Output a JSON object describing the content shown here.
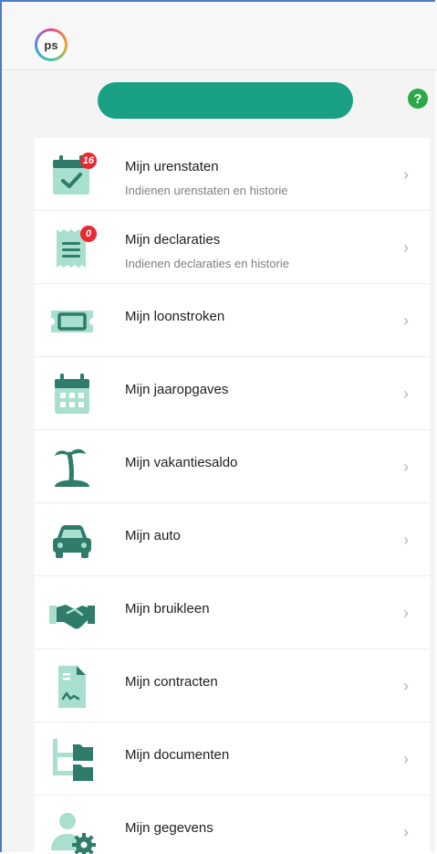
{
  "brand": {
    "logo_text": "ps",
    "accent": "#1aa184"
  },
  "help_label": "?",
  "menu": [
    {
      "title": "Mijn urenstaten",
      "subtitle": "Indienen urenstaten en historie",
      "badge": "16",
      "icon": "timesheet-calendar-icon"
    },
    {
      "title": "Mijn declaraties",
      "subtitle": "Indienen declaraties en historie",
      "badge": "0",
      "icon": "receipt-icon"
    },
    {
      "title": "Mijn loonstroken",
      "icon": "payslip-ticket-icon"
    },
    {
      "title": "Mijn jaaropgaves",
      "icon": "calendar-icon"
    },
    {
      "title": "Mijn vakantiesaldo",
      "icon": "palm-tree-island-icon"
    },
    {
      "title": "Mijn auto",
      "icon": "car-icon"
    },
    {
      "title": "Mijn bruikleen",
      "icon": "handshake-icon"
    },
    {
      "title": "Mijn contracten",
      "icon": "signed-contract-icon"
    },
    {
      "title": "Mijn documenten",
      "icon": "folder-tree-icon"
    },
    {
      "title": "Mijn gegevens",
      "icon": "user-settings-icon"
    }
  ],
  "colors": {
    "icon_dark": "#2f7c6a",
    "icon_light": "#a8dfcf",
    "badge": "#e8292f",
    "help": "#2ba84a"
  }
}
